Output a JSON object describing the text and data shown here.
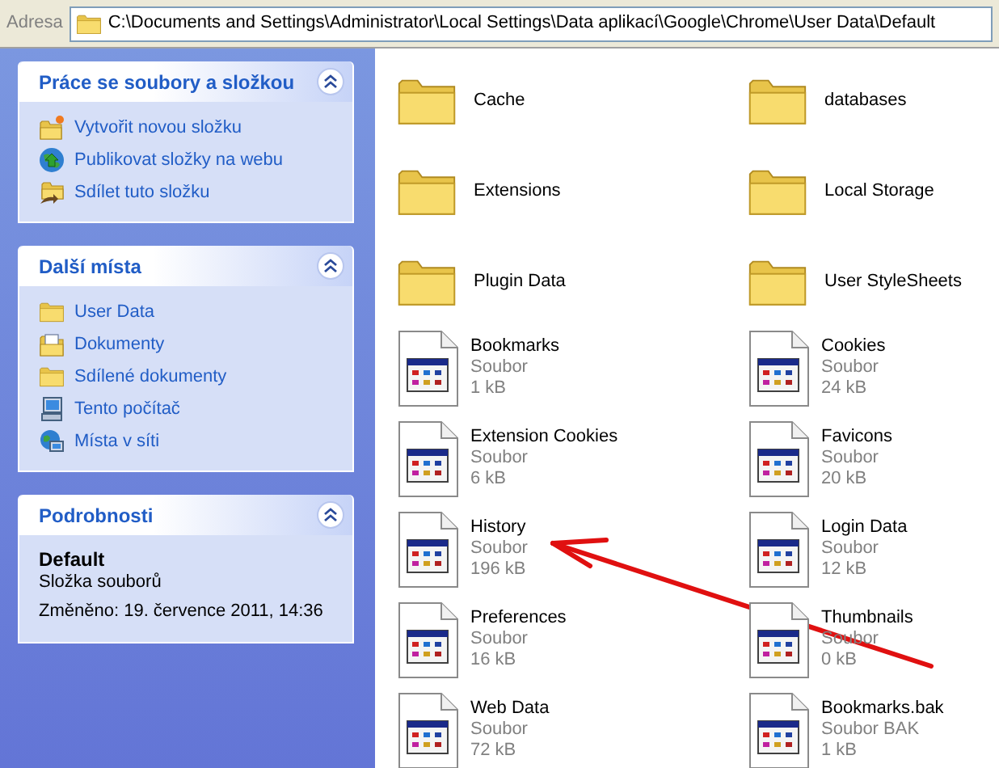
{
  "address_bar": {
    "label": "Adresa",
    "path": "C:\\Documents and Settings\\Administrator\\Local Settings\\Data aplikací\\Google\\Chrome\\User Data\\Default"
  },
  "sidebar": {
    "panels": [
      {
        "kind": "links",
        "title": "Práce se soubory a složkou",
        "expanded": true,
        "items": [
          "Vytvořit novou složku",
          "Publikovat složky na webu",
          "Sdílet tuto složku"
        ]
      },
      {
        "kind": "links",
        "title": "Další místa",
        "expanded": true,
        "items": [
          "User Data",
          "Dokumenty",
          "Sdílené dokumenty",
          "Tento počítač",
          "Místa v síti"
        ]
      },
      {
        "kind": "details",
        "title": "Podrobnosti",
        "expanded": true,
        "name": "Default",
        "type": "Složka souborů",
        "modified": "Změněno: 19. července 2011, 14:36"
      }
    ]
  },
  "files": [
    {
      "kind": "folder",
      "name": "Cache"
    },
    {
      "kind": "folder",
      "name": "databases"
    },
    {
      "kind": "folder",
      "name": "Extensions"
    },
    {
      "kind": "folder",
      "name": "Local Storage"
    },
    {
      "kind": "folder",
      "name": "Plugin Data"
    },
    {
      "kind": "folder",
      "name": "User StyleSheets"
    },
    {
      "kind": "file",
      "name": "Bookmarks",
      "type": "Soubor",
      "size": "1 kB"
    },
    {
      "kind": "file",
      "name": "Cookies",
      "type": "Soubor",
      "size": "24 kB"
    },
    {
      "kind": "file",
      "name": "Extension Cookies",
      "type": "Soubor",
      "size": "6 kB"
    },
    {
      "kind": "file",
      "name": "Favicons",
      "type": "Soubor",
      "size": "20 kB"
    },
    {
      "kind": "file",
      "name": "History",
      "type": "Soubor",
      "size": "196 kB"
    },
    {
      "kind": "file",
      "name": "Login Data",
      "type": "Soubor",
      "size": "12 kB"
    },
    {
      "kind": "file",
      "name": "Preferences",
      "type": "Soubor",
      "size": "16 kB"
    },
    {
      "kind": "file",
      "name": "Thumbnails",
      "type": "Soubor",
      "size": "0 kB"
    },
    {
      "kind": "file",
      "name": "Web Data",
      "type": "Soubor",
      "size": "72 kB"
    },
    {
      "kind": "file",
      "name": "Bookmarks.bak",
      "type": "Soubor BAK",
      "size": "1 kB"
    }
  ]
}
